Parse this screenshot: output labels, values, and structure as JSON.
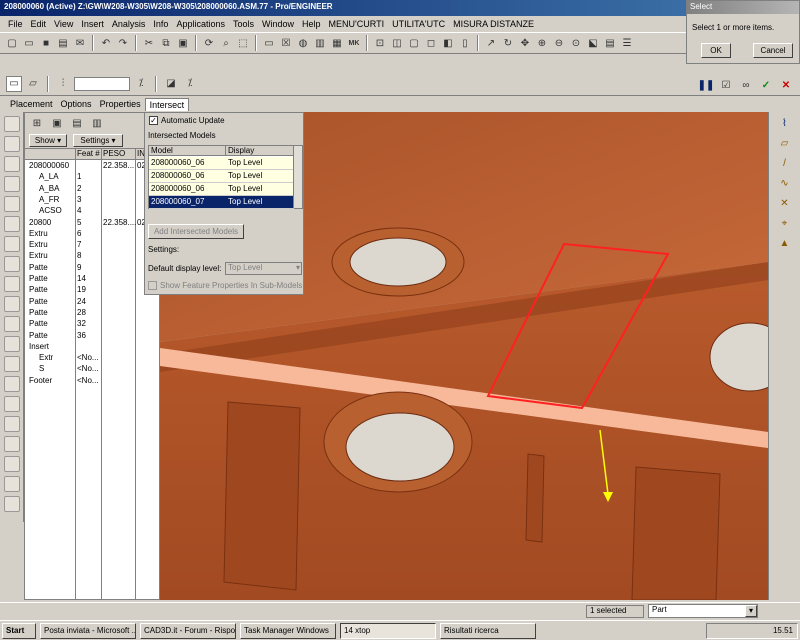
{
  "window": {
    "title": "208000060 (Active) Z:\\GW\\W208-W305\\W208-W305\\208000060.ASM.77 - Pro/ENGINEER"
  },
  "menu": [
    "File",
    "Edit",
    "View",
    "Insert",
    "Analysis",
    "Info",
    "Applications",
    "Tools",
    "Window",
    "Help",
    "MENU'CURTI",
    "UTILITA'UTC",
    "MISURA DISTANZE"
  ],
  "select_dialog": {
    "title": "Select",
    "message": "Select 1 or more items.",
    "ok": "OK",
    "cancel": "Cancel"
  },
  "tabs": [
    "Placement",
    "Options",
    "Properties",
    "Intersect"
  ],
  "tree": {
    "show_label": "Show",
    "settings_label": "Settings",
    "columns": [
      "Feat #",
      "PESO",
      "IN"
    ],
    "rows": [
      {
        "name": "208000060",
        "feat": "",
        "peso": "22.358...",
        "in": "02"
      },
      {
        "name": "A_LA",
        "feat": "1",
        "peso": "",
        "in": ""
      },
      {
        "name": "A_BA",
        "feat": "2",
        "peso": "",
        "in": ""
      },
      {
        "name": "A_FR",
        "feat": "3",
        "peso": "",
        "in": ""
      },
      {
        "name": "ACSO",
        "feat": "4",
        "peso": "",
        "in": ""
      },
      {
        "name": "20800",
        "feat": "5",
        "peso": "22.358....",
        "in": "02"
      },
      {
        "name": "Extru",
        "feat": "6",
        "peso": "",
        "in": ""
      },
      {
        "name": "Extru",
        "feat": "7",
        "peso": "",
        "in": ""
      },
      {
        "name": "Extru",
        "feat": "8",
        "peso": "",
        "in": ""
      },
      {
        "name": "Patte",
        "feat": "9",
        "peso": "",
        "in": ""
      },
      {
        "name": "Patte",
        "feat": "14",
        "peso": "",
        "in": ""
      },
      {
        "name": "Patte",
        "feat": "19",
        "peso": "",
        "in": ""
      },
      {
        "name": "Patte",
        "feat": "24",
        "peso": "",
        "in": ""
      },
      {
        "name": "Patte",
        "feat": "28",
        "peso": "",
        "in": ""
      },
      {
        "name": "Patte",
        "feat": "32",
        "peso": "",
        "in": ""
      },
      {
        "name": "Patte",
        "feat": "36",
        "peso": "",
        "in": ""
      },
      {
        "name": "Insert",
        "feat": "",
        "peso": "",
        "in": ""
      },
      {
        "name": "Extr",
        "feat": "<No...",
        "peso": "",
        "in": ""
      },
      {
        "name": "S",
        "feat": "<No...",
        "peso": "",
        "in": ""
      },
      {
        "name": "Footer",
        "feat": "<No...",
        "peso": "",
        "in": ""
      }
    ]
  },
  "intersect": {
    "auto_update_label": "Automatic Update",
    "auto_update_checked": true,
    "section_label": "Intersected Models",
    "col_model": "Model",
    "col_display": "Display",
    "models": [
      {
        "model": "208000060_06",
        "display": "Top Level"
      },
      {
        "model": "208000060_06",
        "display": "Top Level"
      },
      {
        "model": "208000060_06",
        "display": "Top Level"
      },
      {
        "model": "208000060_07",
        "display": "Top Level"
      }
    ],
    "add_button": "Add Intersected Models",
    "settings_label": "Settings:",
    "default_display_label": "Default display level:",
    "default_display_value": "Top Level",
    "show_feature_label": "Show Feature Properties In Sub-Models"
  },
  "status": {
    "selected": "1 selected",
    "filter": "Part"
  },
  "taskbar": {
    "start": "Start",
    "items": [
      "Posta inviata - Microsoft ...",
      "CAD3D.it - Forum - Rispo...",
      "Task Manager Windows",
      "14 xtop",
      "Risultati ricerca"
    ],
    "clock": "15.51"
  },
  "colors": {
    "part": "#b5552a",
    "highlight": "#ff2020",
    "datum": "#f7b99a"
  }
}
